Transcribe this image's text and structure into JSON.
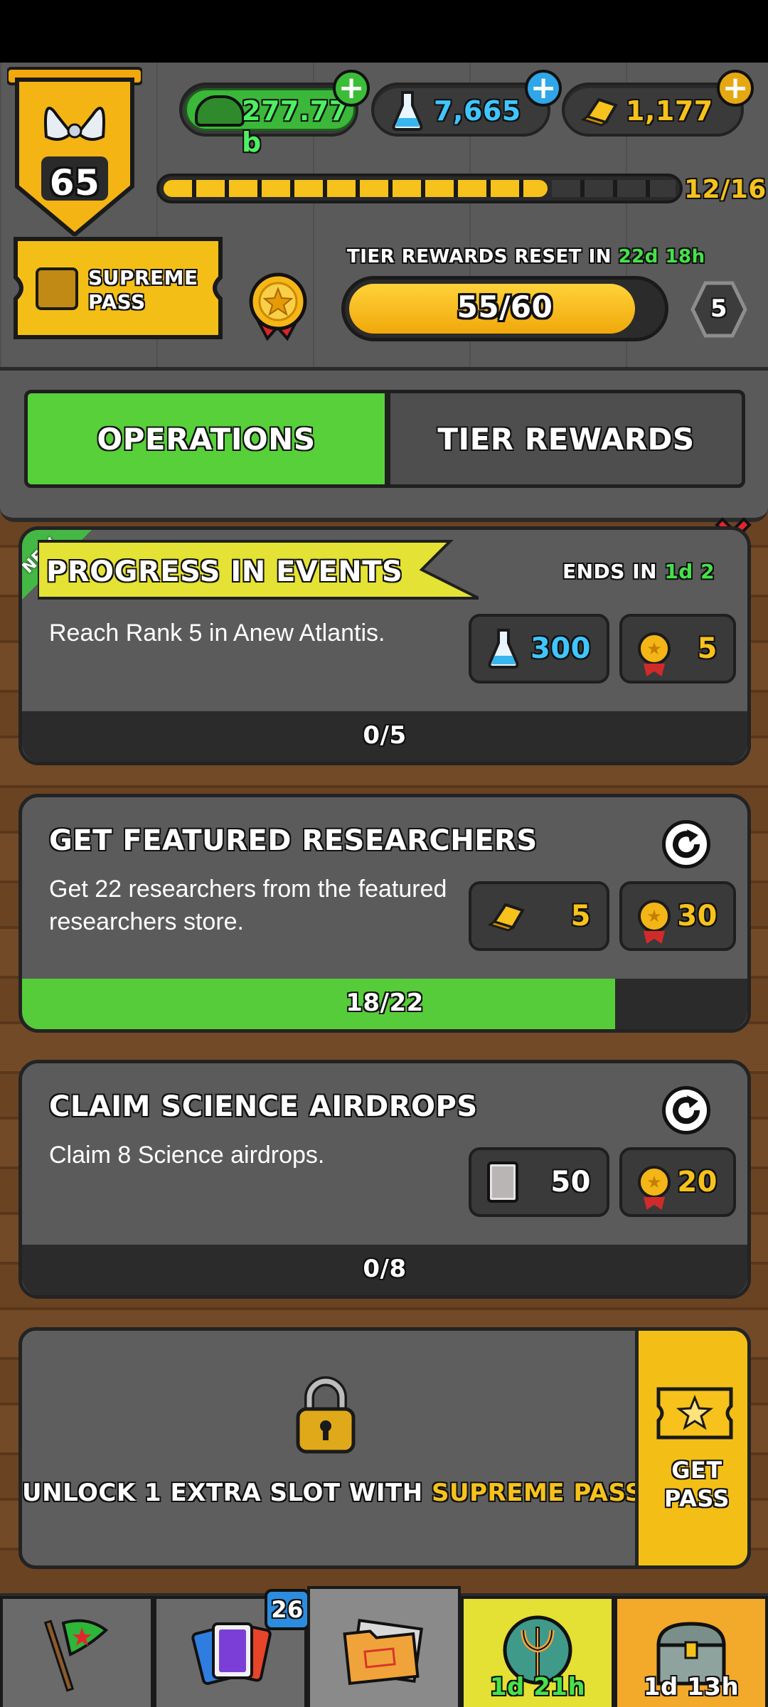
{
  "header": {
    "level": "65",
    "currencies": [
      {
        "icon": "army-cap-icon",
        "value": "277.77 b",
        "color": "#2ad14a"
      },
      {
        "icon": "flask-icon",
        "value": "7,665",
        "color": "#3fc6ff"
      },
      {
        "icon": "gold-bar-icon",
        "value": "1,177",
        "color": "#f6c21b"
      }
    ],
    "xp_progress": "12/16",
    "xp_fraction": 0.75
  },
  "pass": {
    "label": "SUPREME PASS",
    "tier_reset_label": "TIER REWARDS RESET IN",
    "tier_reset_time": "22d 18h",
    "tier_progress": "55/60",
    "tier_fraction": 0.9167,
    "tier_level": "5"
  },
  "tabs": [
    {
      "label": "OPERATIONS",
      "active": true
    },
    {
      "label": "TIER REWARDS",
      "active": false
    }
  ],
  "operations": [
    {
      "badge": "NEW",
      "title": "PROGRESS IN EVENTS",
      "ends_label": "ENDS IN",
      "ends_time": "1d 2",
      "description": "Reach Rank 5 in Anew Atlantis.",
      "rewards": [
        {
          "icon": "flask-icon",
          "value": "300",
          "color": "#3fc6ff"
        },
        {
          "icon": "medal-icon",
          "value": "5",
          "color": "#f6c21b"
        }
      ],
      "progress": "0/5",
      "fraction": 0
    },
    {
      "title": "GET FEATURED RESEARCHERS",
      "description": "Get 22 researchers from the featured researchers store.",
      "rewards": [
        {
          "icon": "gold-bar-icon",
          "value": "5",
          "color": "#f6c21b"
        },
        {
          "icon": "medal-icon",
          "value": "30",
          "color": "#f6c21b"
        }
      ],
      "progress": "18/22",
      "fraction": 0.818
    },
    {
      "title": "CLAIM SCIENCE AIRDROPS",
      "description": "Claim 8 Science airdrops.",
      "rewards": [
        {
          "icon": "card-icon",
          "value": "50",
          "color": "#ffffff"
        },
        {
          "icon": "medal-icon",
          "value": "20",
          "color": "#f6c21b"
        }
      ],
      "progress": "0/8",
      "fraction": 0
    }
  ],
  "unlock": {
    "text_prefix": "UNLOCK 1 EXTRA SLOT WITH",
    "text_highlight": "SUPREME PASS",
    "button": "GET PASS"
  },
  "nav": [
    {
      "icon": "flag-icon",
      "label": ""
    },
    {
      "icon": "cards-icon",
      "badge": "26"
    },
    {
      "icon": "folder-icon",
      "label": ""
    },
    {
      "icon": "trident-icon",
      "timer": "1d 21h"
    },
    {
      "icon": "treasure-chest-icon",
      "timer": "1d 13h"
    }
  ]
}
